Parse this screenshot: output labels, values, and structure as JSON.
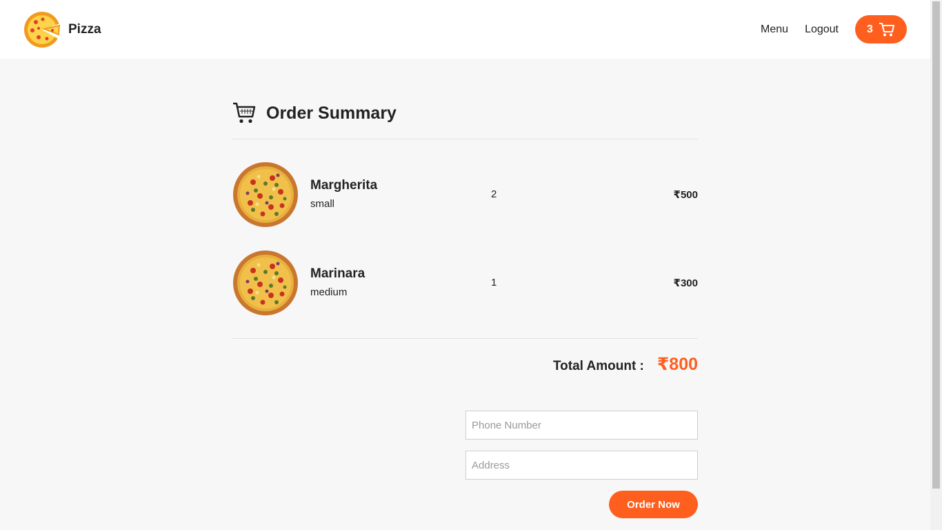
{
  "brand": {
    "name": "Pizza",
    "logo_icon": "pizza-logo-icon"
  },
  "nav": {
    "menu_label": "Menu",
    "logout_label": "Logout",
    "cart_count": "3",
    "cart_icon": "cart-icon"
  },
  "summary": {
    "title": "Order Summary",
    "title_icon": "cart-outline-icon"
  },
  "items": [
    {
      "name": "Margherita",
      "size": "small",
      "qty": "2",
      "price": "₹500",
      "image_icon": "pizza-image"
    },
    {
      "name": "Marinara",
      "size": "medium",
      "qty": "1",
      "price": "₹300",
      "image_icon": "pizza-image"
    }
  ],
  "total": {
    "label": "Total Amount :",
    "value": "₹800"
  },
  "form": {
    "phone_placeholder": "Phone Number",
    "phone_value": "",
    "address_placeholder": "Address",
    "address_value": "",
    "submit_label": "Order Now"
  },
  "colors": {
    "accent": "#fe5f1e",
    "page_bg": "#f7f7f7",
    "nav_bg": "#ffffff"
  }
}
